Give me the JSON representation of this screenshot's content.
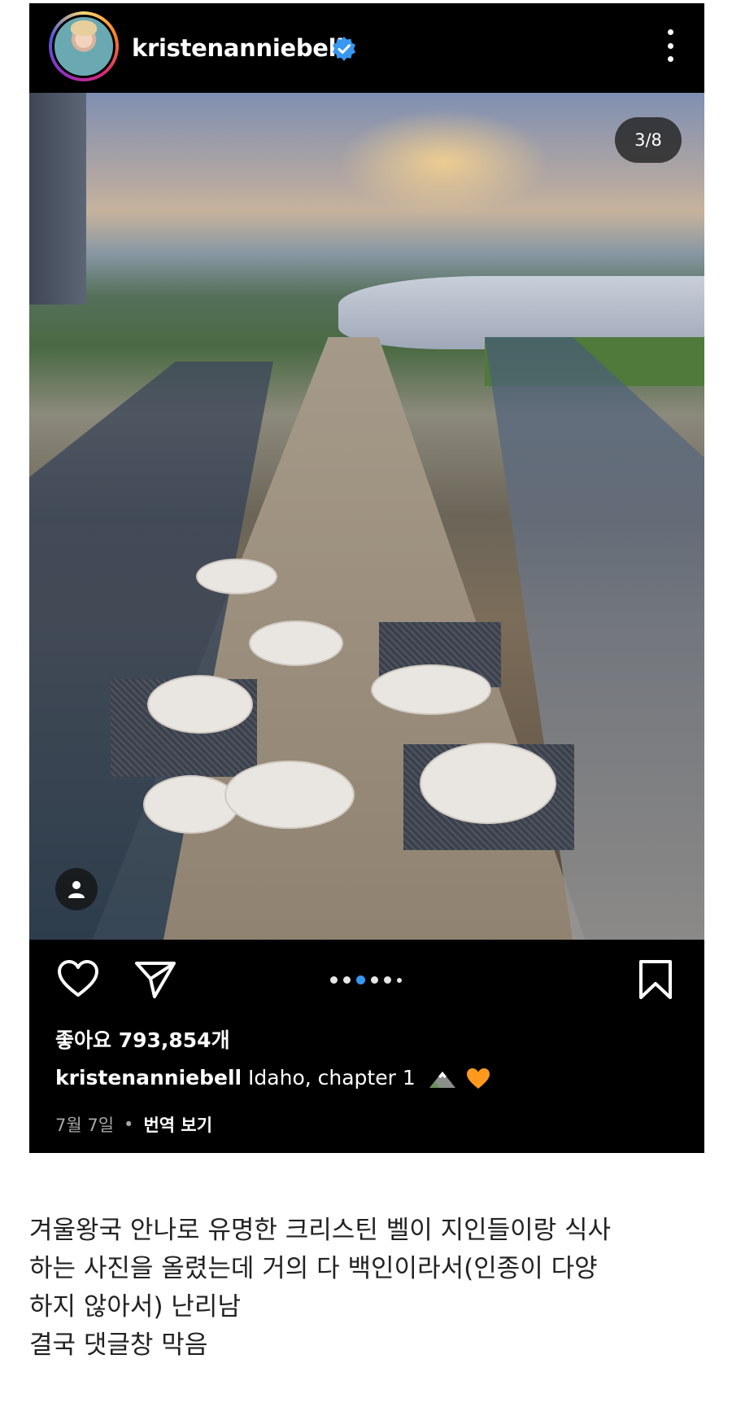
{
  "post": {
    "username": "kristenanniebell",
    "verified": true,
    "carousel_counter": "3/8",
    "carousel": {
      "current": 3,
      "total": 8
    },
    "likes_text": "좋아요 793,854개",
    "caption": {
      "username": "kristenanniebell",
      "text": "Idaho, chapter 1",
      "emojis": [
        "mountain-emoji",
        "orange-heart-emoji"
      ]
    },
    "date": "7월 7일",
    "separator": "•",
    "translate_label": "번역 보기",
    "accent_color": "#3897f0",
    "verified_color": "#3897f0"
  },
  "article": {
    "lines": [
      "겨울왕국 안나로 유명한 크리스틴 벨이 지인들이랑 식사",
      "하는 사진을 올렸는데 거의 다 백인이라서(인종이 다양",
      "하지 않아서) 난리남",
      "결국 댓글창 막음"
    ]
  },
  "icons": [
    "more-icon",
    "heart-icon",
    "send-icon",
    "bookmark-icon",
    "user-tag-icon",
    "verified-icon"
  ]
}
